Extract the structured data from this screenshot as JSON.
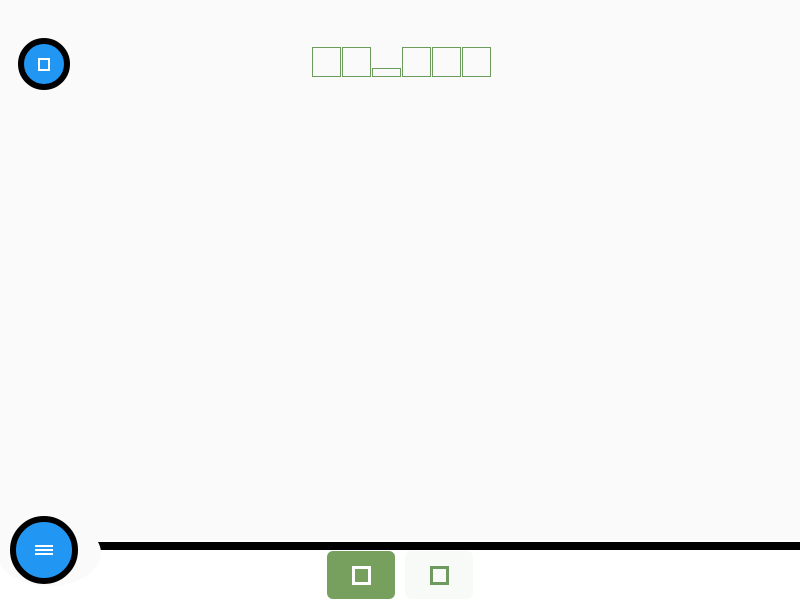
{
  "title": {
    "glyphs": [
      "box",
      "box",
      "dash",
      "box",
      "box",
      "box"
    ]
  },
  "top_button": {
    "icon": "square-icon",
    "color": "#2196f3"
  },
  "menu_button": {
    "icon": "menu-icon",
    "color": "#2196f3"
  },
  "bottom_nav": {
    "items": [
      {
        "icon": "square-icon",
        "active": true,
        "active_color": "#77a05f"
      },
      {
        "icon": "square-icon",
        "active": false,
        "icon_color": "#6d9a5d"
      }
    ]
  }
}
